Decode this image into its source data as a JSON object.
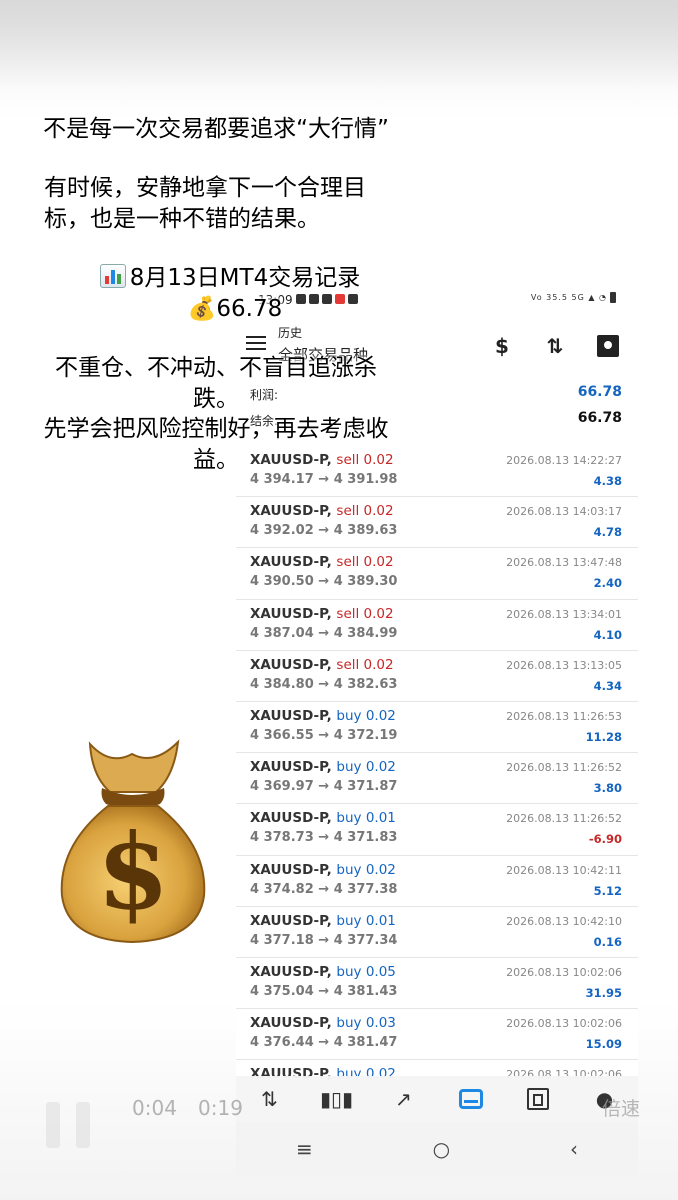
{
  "overlay": {
    "headline": "不是每一次交易都要追求“大行情”",
    "body": "有时候，安静地拿下一个合理目标，也是一种不错的结果。",
    "date_line": "8月13日MT4交易记录",
    "amount": "66.78",
    "discipline": "不重仓、不冲动、不盲目追涨杀跌。",
    "risk": "先学会把风险控制好，再去考虑收益。"
  },
  "status_bar": {
    "time": "13:09",
    "network": "Vo 35.5 5G"
  },
  "header": {
    "title": "历史",
    "subtitle": "全部交易品种"
  },
  "summary": {
    "profit_label": "利润:",
    "profit_value": "66.78",
    "balance_label": "结余:",
    "balance_value": "66.78"
  },
  "trades": [
    {
      "symbol": "XAUUSD-P,",
      "side": "sell",
      "lots": "0.02",
      "open": "4 394.17",
      "close": "4 391.98",
      "time": "2026.08.13 14:22:27",
      "pl": "4.38"
    },
    {
      "symbol": "XAUUSD-P,",
      "side": "sell",
      "lots": "0.02",
      "open": "4 392.02",
      "close": "4 389.63",
      "time": "2026.08.13 14:03:17",
      "pl": "4.78"
    },
    {
      "symbol": "XAUUSD-P,",
      "side": "sell",
      "lots": "0.02",
      "open": "4 390.50",
      "close": "4 389.30",
      "time": "2026.08.13 13:47:48",
      "pl": "2.40"
    },
    {
      "symbol": "XAUUSD-P,",
      "side": "sell",
      "lots": "0.02",
      "open": "4 387.04",
      "close": "4 384.99",
      "time": "2026.08.13 13:34:01",
      "pl": "4.10"
    },
    {
      "symbol": "XAUUSD-P,",
      "side": "sell",
      "lots": "0.02",
      "open": "4 384.80",
      "close": "4 382.63",
      "time": "2026.08.13 13:13:05",
      "pl": "4.34"
    },
    {
      "symbol": "XAUUSD-P,",
      "side": "buy",
      "lots": "0.02",
      "open": "4 366.55",
      "close": "4 372.19",
      "time": "2026.08.13 11:26:53",
      "pl": "11.28"
    },
    {
      "symbol": "XAUUSD-P,",
      "side": "buy",
      "lots": "0.02",
      "open": "4 369.97",
      "close": "4 371.87",
      "time": "2026.08.13 11:26:52",
      "pl": "3.80"
    },
    {
      "symbol": "XAUUSD-P,",
      "side": "buy",
      "lots": "0.01",
      "open": "4 378.73",
      "close": "4 371.83",
      "time": "2026.08.13 11:26:52",
      "pl": "-6.90"
    },
    {
      "symbol": "XAUUSD-P,",
      "side": "buy",
      "lots": "0.02",
      "open": "4 374.82",
      "close": "4 377.38",
      "time": "2026.08.13 10:42:11",
      "pl": "5.12"
    },
    {
      "symbol": "XAUUSD-P,",
      "side": "buy",
      "lots": "0.01",
      "open": "4 377.18",
      "close": "4 377.34",
      "time": "2026.08.13 10:42:10",
      "pl": "0.16"
    },
    {
      "symbol": "XAUUSD-P,",
      "side": "buy",
      "lots": "0.05",
      "open": "4 375.04",
      "close": "4 381.43",
      "time": "2026.08.13 10:02:06",
      "pl": "31.95"
    },
    {
      "symbol": "XAUUSD-P,",
      "side": "buy",
      "lots": "0.03",
      "open": "4 376.44",
      "close": "4 381.47",
      "time": "2026.08.13 10:02:06",
      "pl": "15.09"
    },
    {
      "symbol": "XAUUSD-P,",
      "side": "buy",
      "lots": "0.02",
      "open": "",
      "close": "",
      "time": "2026.08.13 10:02:06",
      "pl": ""
    }
  ],
  "tabs": [
    "quotes-icon",
    "chart-icon",
    "trade-icon",
    "history-icon",
    "news-icon",
    "messages-icon"
  ],
  "video": {
    "current_time": "0:04",
    "duration": "0:19",
    "speed_label": "倍速"
  },
  "colors": {
    "sell": "#c62828",
    "buy": "#1565c0",
    "profit": "#1565c0",
    "loss": "#c62828"
  }
}
